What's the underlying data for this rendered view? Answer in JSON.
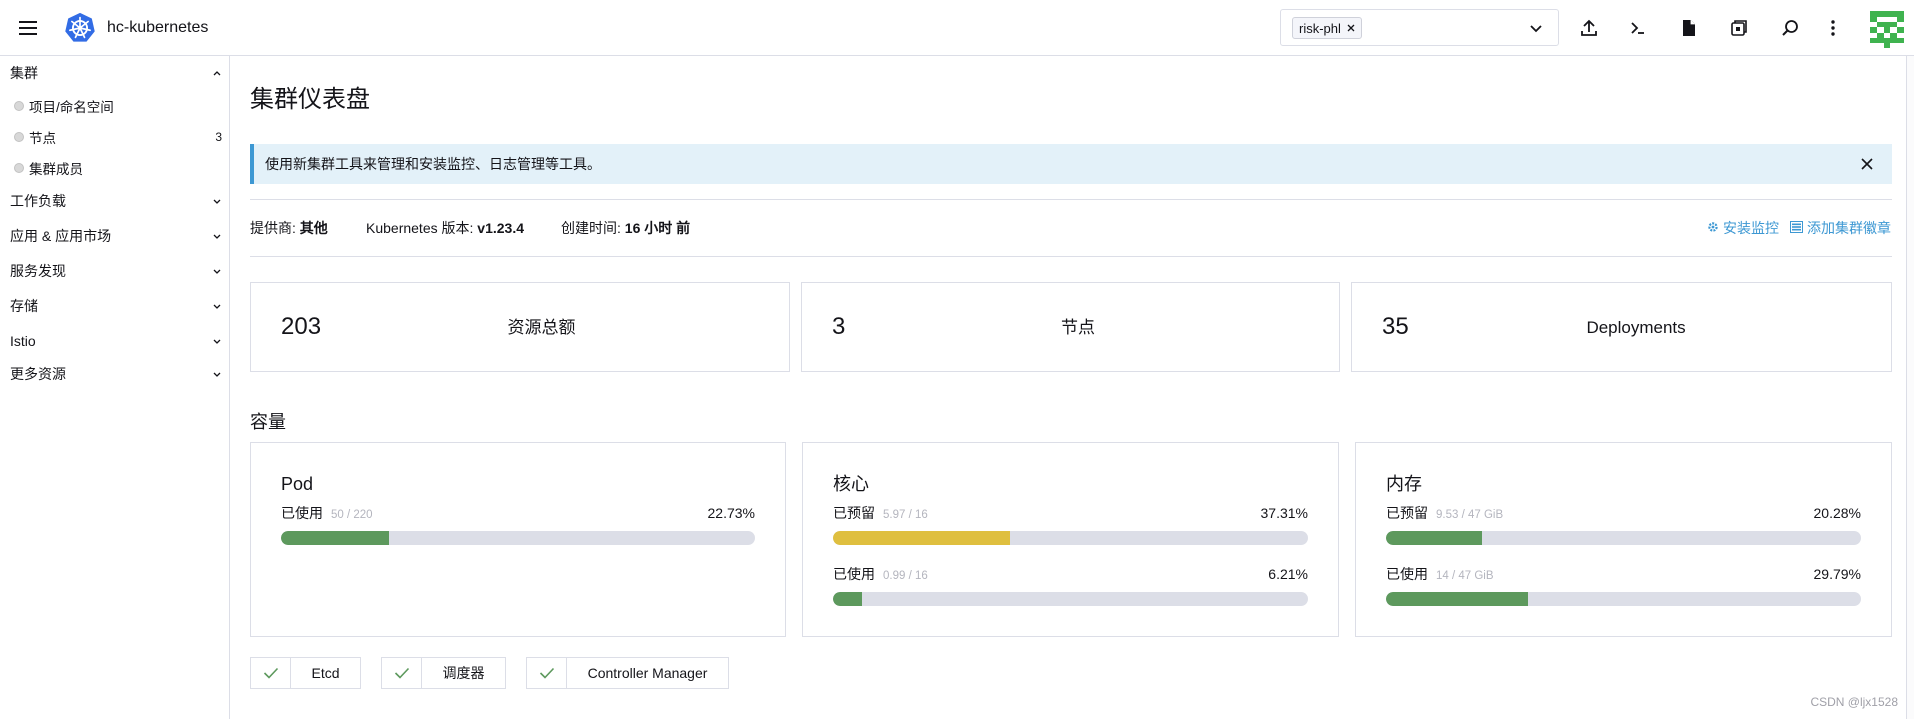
{
  "app": {
    "cluster_name": "hc-kubernetes"
  },
  "header": {
    "namespace_filter": {
      "chip": "risk-phl"
    },
    "actions": [
      {
        "icon": "upload-icon"
      },
      {
        "icon": "terminal-icon"
      },
      {
        "icon": "file-icon"
      },
      {
        "icon": "copy-kubeconfig-icon"
      },
      {
        "icon": "search-icon"
      },
      {
        "icon": "kebab-menu-icon"
      }
    ]
  },
  "sidebar": {
    "sections": [
      {
        "label": "集群",
        "expanded": true,
        "items": [
          {
            "label": "项目/命名空间"
          },
          {
            "label": "节点",
            "count": "3"
          },
          {
            "label": "集群成员"
          }
        ]
      },
      {
        "label": "工作负载"
      },
      {
        "label": "应用 & 应用市场"
      },
      {
        "label": "服务发现"
      },
      {
        "label": "存储"
      },
      {
        "label": "Istio"
      },
      {
        "label": "更多资源"
      }
    ]
  },
  "page": {
    "title": "集群仪表盘"
  },
  "banner": {
    "text": "使用新集群工具来管理和安装监控、日志管理等工具。"
  },
  "info": {
    "provider_label": "提供商:",
    "provider_value": "其他",
    "k8s_label": "Kubernetes 版本:",
    "k8s_value": "v1.23.4",
    "created_label": "创建时间:",
    "created_value": "16 小时 前",
    "install_monitoring": "安装监控",
    "add_badge": "添加集群徽章"
  },
  "counts": [
    {
      "value": "203",
      "label": "资源总额"
    },
    {
      "value": "3",
      "label": "节点"
    },
    {
      "value": "35",
      "label": "Deployments"
    }
  ],
  "capacity": {
    "heading": "容量",
    "cards": [
      {
        "title": "Pod",
        "rows": [
          {
            "label": "已使用",
            "amount": "50 / 220",
            "percent": "22.73%",
            "color": "#5d995d"
          }
        ]
      },
      {
        "title": "核心",
        "rows": [
          {
            "label": "已预留",
            "amount": "5.97 / 16",
            "percent": "37.31%",
            "color": "#dfbf3f"
          },
          {
            "label": "已使用",
            "amount": "0.99 / 16",
            "percent": "6.21%",
            "color": "#5d995d"
          }
        ]
      },
      {
        "title": "内存",
        "rows": [
          {
            "label": "已预留",
            "amount": "9.53 / 47 GiB",
            "percent": "20.28%",
            "color": "#5d995d"
          },
          {
            "label": "已使用",
            "amount": "14 / 47 GiB",
            "percent": "29.79%",
            "color": "#5d995d"
          }
        ]
      }
    ]
  },
  "components": [
    {
      "label": "Etcd",
      "status": "ok"
    },
    {
      "label": "调度器",
      "status": "ok"
    },
    {
      "label": "Controller Manager",
      "status": "ok"
    }
  ],
  "watermark": "CSDN @ljx1528",
  "colors": {
    "accent": "#3d98d3",
    "success": "#5d995d",
    "warning": "#dfbf3f",
    "border": "#dcdee7",
    "k8s_blue": "#326ce5",
    "avatar_green": "#3fb34f"
  }
}
